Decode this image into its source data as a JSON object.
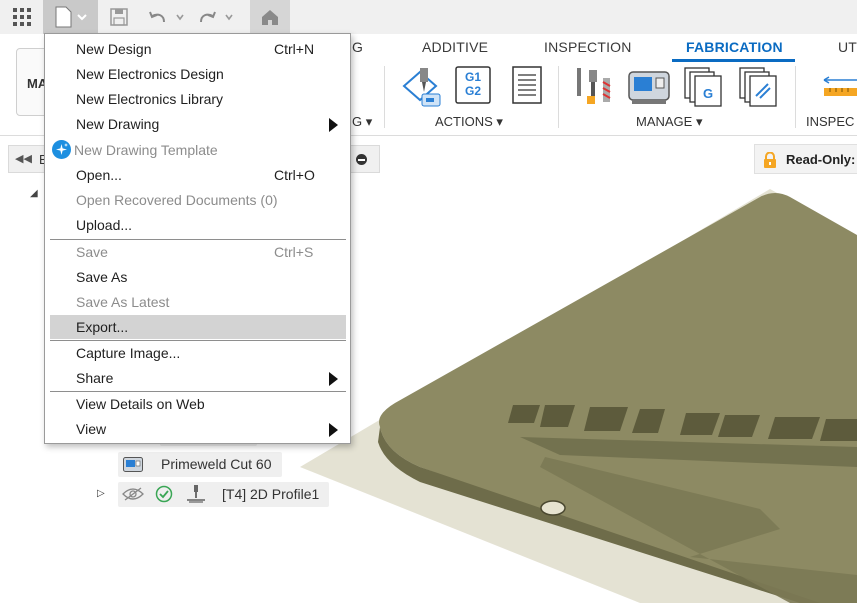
{
  "toolbar": {
    "mode_label": "MA",
    "tabs": [
      "G",
      "ADDITIVE",
      "INSPECTION",
      "FABRICATION",
      "UT"
    ],
    "groups": {
      "g_partial": "G",
      "actions": "ACTIONS",
      "manage": "MANAGE",
      "inspect": "INSPEC"
    },
    "g1g2_line1": "G1",
    "g1g2_line2": "G2",
    "g_doc": "G"
  },
  "browser": {
    "title_partial": "B",
    "items": [
      {
        "label": "Primeweld Cut 60"
      },
      {
        "label": "[T4] 2D Profile1"
      }
    ]
  },
  "status": {
    "readonly": "Read-Only:"
  },
  "file_menu": {
    "items": [
      {
        "label": "New Design",
        "shortcut": "Ctrl+N"
      },
      {
        "label": "New Electronics Design"
      },
      {
        "label": "New Electronics Library"
      },
      {
        "label": "New Drawing"
      },
      {
        "label": "New Drawing Template"
      },
      {
        "label": "Open...",
        "shortcut": "Ctrl+O"
      },
      {
        "label": "Open Recovered Documents (0)"
      },
      {
        "label": "Upload..."
      },
      {
        "label": "Save",
        "shortcut": "Ctrl+S"
      },
      {
        "label": "Save As"
      },
      {
        "label": "Save As Latest"
      },
      {
        "label": "Export..."
      },
      {
        "label": "Capture Image..."
      },
      {
        "label": "Share"
      },
      {
        "label": "View Details on Web"
      },
      {
        "label": "View"
      }
    ]
  },
  "colors": {
    "accent": "#0a6bc2",
    "plate": "#8a8760",
    "plate_top": "#a3a07a",
    "lock": "#f5a623"
  }
}
